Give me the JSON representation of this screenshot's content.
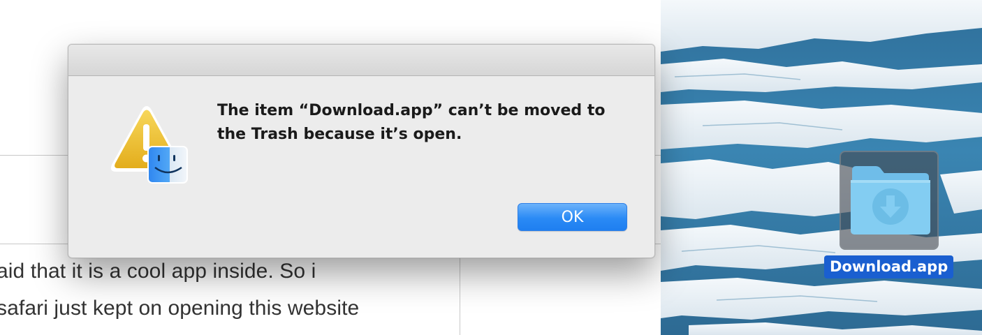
{
  "document": {
    "lines": [
      "aid that it is a cool app inside. So i",
      "safari just kept on opening this website"
    ]
  },
  "alert": {
    "message_line_1": "The item “Download.app” can’t be moved to",
    "message_line_2": "the Trash because it’s open.",
    "ok_label": "OK",
    "icon": "warning-finder-icon"
  },
  "desktop": {
    "icon_label": "Download.app",
    "icon": "downloads-folder-icon",
    "label_color": "#1a5fd0"
  },
  "colors": {
    "button_accent": "#2a8af5",
    "dialog_background": "#ececec",
    "warning_yellow": "#f2c230"
  }
}
